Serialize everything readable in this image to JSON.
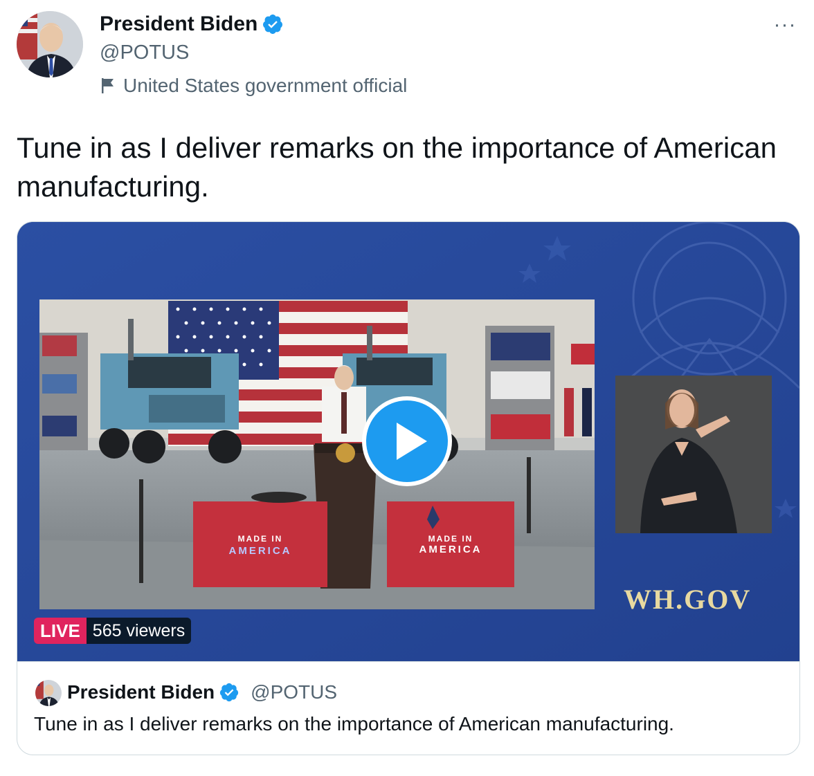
{
  "author": {
    "display_name": "President Biden",
    "handle": "@POTUS",
    "label": "United States government official",
    "verified": true
  },
  "tweet": {
    "text": "Tune in as I deliver remarks on the importance of American manufacturing."
  },
  "video": {
    "live_label": "LIVE",
    "viewers": "565 viewers",
    "watermark": "WH.GOV"
  },
  "card_footer": {
    "display_name": "President Biden",
    "handle": "@POTUS",
    "text": "Tune in as I deliver remarks on the importance of American manufacturing."
  },
  "colors": {
    "verified": "#1d9bf0",
    "live": "#e0245e",
    "video_bg": "#2a4a9a",
    "play_button": "#1d9bf0"
  },
  "icons": {
    "more": "more-dots-icon",
    "verified": "verified-badge-icon",
    "flag": "flag-icon",
    "play": "play-icon"
  }
}
